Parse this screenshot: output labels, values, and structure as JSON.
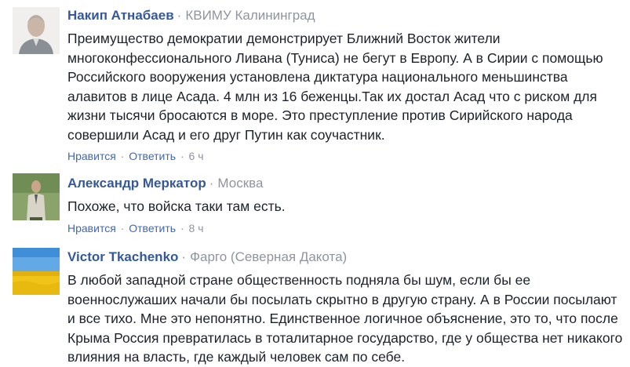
{
  "comments": [
    {
      "author": "Накип Атнабаев",
      "location": "КВИМУ Калининград",
      "text": "Преимущество демократии демонстрирует Ближний Восток жители многоконфессионального Ливана (Туниса) не бегут в Европу. А в Сирии с помощью Российского вооружения установлена диктатура национального меньшинства алавитов в лице Асада. 4 млн из 16 беженцы.Так их достал Асад что с риском для жизни тысячи бросаются в море. Это преступление против Сирийского народа совершили Асад и его друг Путин как соучастник.",
      "like_label": "Нравится",
      "reply_label": "Ответить",
      "time": "6 ч"
    },
    {
      "author": "Александр Меркатор",
      "location": "Москва",
      "text": "Похоже, что войска таки там есть.",
      "like_label": "Нравится",
      "reply_label": "Ответить",
      "time": "8 ч"
    },
    {
      "author": "Victor Tkachenko",
      "location": "Фарго (Северная Дакота)",
      "text": "В любой западной стране общественность подняла бы шум, если бы ее военнослужаших начали бы посылать скрытно в другую страну. А в России посылают и все тихо. Мне это непонятно. Единственное логичное объяснение, это то, что после Крыма Россия превратилась в тоталитарное государство, где у общества нет никакого влияния на власть, где каждый человек сам по себе."
    }
  ],
  "separator": "·",
  "colors": {
    "author": "#365899",
    "link": "#4267b2",
    "muted": "#90949c",
    "text": "#1d2129"
  },
  "icons": [
    "avatar-elderly-man",
    "avatar-man-in-suit",
    "avatar-ukraine-flag-field"
  ]
}
